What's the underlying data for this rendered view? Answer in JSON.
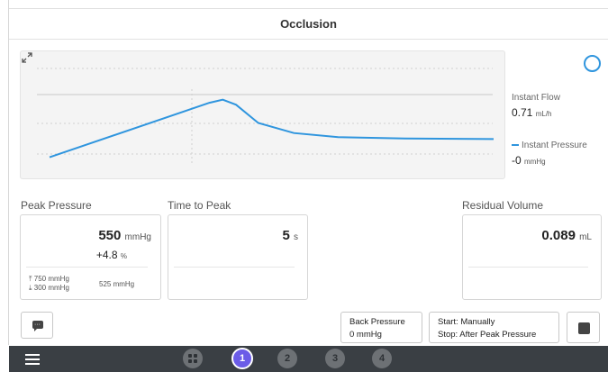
{
  "window": {
    "title": "Occlusion"
  },
  "chart": {
    "legend": {
      "flow_label": "Instant Flow",
      "flow_value": "0.71",
      "flow_unit": "mL/h",
      "pressure_label": "Instant Pressure",
      "pressure_value": "-0",
      "pressure_unit": "mmHg"
    },
    "accent_color": "#2f95de",
    "series": [
      {
        "t": 0,
        "p": 0.12
      },
      {
        "t": 0.36,
        "p": 0.66
      },
      {
        "t": 0.39,
        "p": 0.69
      },
      {
        "t": 0.42,
        "p": 0.64
      },
      {
        "t": 0.47,
        "p": 0.46
      },
      {
        "t": 0.55,
        "p": 0.36
      },
      {
        "t": 0.65,
        "p": 0.32
      },
      {
        "t": 0.8,
        "p": 0.305
      },
      {
        "t": 1,
        "p": 0.3
      }
    ]
  },
  "peak_pressure": {
    "label": "Peak Pressure",
    "value": "550",
    "unit": "mmHg",
    "delta": "+4.8",
    "delta_unit": "%",
    "upper_limit": "750 mmHg",
    "lower_limit": "300 mmHg",
    "setpoint": "525 mmHg"
  },
  "time_to_peak": {
    "label": "Time to Peak",
    "value": "5",
    "unit": "s"
  },
  "residual_volume": {
    "label": "Residual Volume",
    "value": "0.089",
    "unit": "mL"
  },
  "back_pressure": {
    "label": "Back Pressure",
    "value": "0 mmHg"
  },
  "run": {
    "start": "Start: Manually",
    "stop": "Stop: After Peak Pressure"
  },
  "nav": {
    "steps": [
      "1",
      "2",
      "3",
      "4"
    ],
    "active_step": "1",
    "active_color": "#6b5ce7"
  }
}
